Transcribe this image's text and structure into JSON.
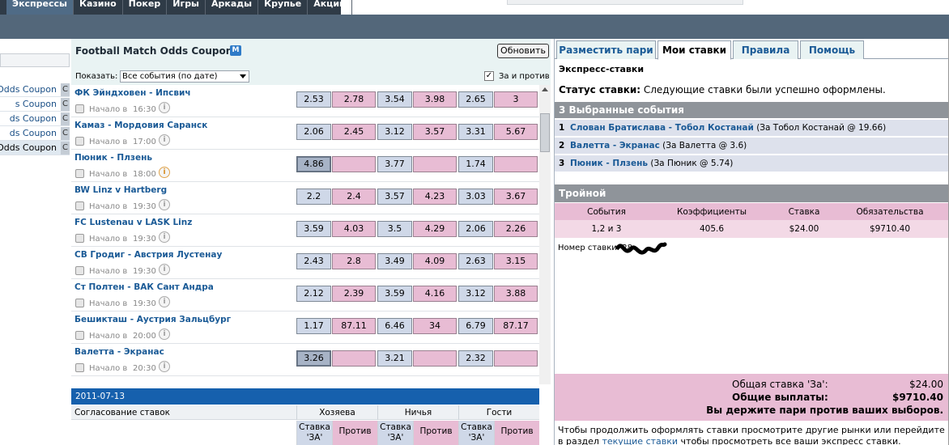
{
  "topnav": {
    "tabs": [
      "Экспрессы",
      "Казино",
      "Покер",
      "Игры",
      "Аркады",
      "Крупье",
      "Акции"
    ]
  },
  "sidebar": {
    "items": [
      "Odds Coupon",
      "s Coupon",
      "ds Coupon",
      "ds Coupon",
      "Odds Coupon"
    ],
    "c_label": "C"
  },
  "coupon": {
    "title": "Football Match Odds Coupon",
    "badge": "M",
    "refresh_label": "Обновить",
    "show_label": "Показать:",
    "show_value": "Все события (по дате)",
    "za_label": "За и против",
    "start_label": "Начало в",
    "matches": [
      {
        "name": "ФК Эйндховен - Ипсвич",
        "time": "16:30",
        "odds": [
          "2.53",
          "2.78",
          "3.54",
          "3.98",
          "2.65",
          "3"
        ]
      },
      {
        "name": "Камаз - Мордовия Саранск",
        "time": "17:00",
        "odds": [
          "2.06",
          "2.45",
          "3.12",
          "3.57",
          "3.31",
          "5.67"
        ]
      },
      {
        "name": "Пюник - Плзень",
        "time": "18:00",
        "odds": [
          "4.86",
          "",
          "3.77",
          "",
          "1.74",
          ""
        ]
      },
      {
        "name": "BW Linz v Hartberg",
        "time": "19:30",
        "odds": [
          "2.2",
          "2.4",
          "3.57",
          "4.23",
          "3.03",
          "3.67"
        ]
      },
      {
        "name": "FC Lustenau v LASK Linz",
        "time": "19:30",
        "odds": [
          "3.59",
          "4.03",
          "3.5",
          "4.29",
          "2.06",
          "2.26"
        ]
      },
      {
        "name": "СВ Гродиг - Австрия Лустенау",
        "time": "19:30",
        "odds": [
          "2.43",
          "2.8",
          "3.49",
          "4.09",
          "2.63",
          "3.15"
        ]
      },
      {
        "name": "Ст Полтен - ВАК Сант Андра",
        "time": "19:30",
        "odds": [
          "2.12",
          "2.39",
          "3.59",
          "4.16",
          "3.12",
          "3.88"
        ]
      },
      {
        "name": "Бешикташ - Аустрия Зальцбург",
        "time": "20:00",
        "odds": [
          "1.17",
          "87.11",
          "6.46",
          "34",
          "6.79",
          "87.17"
        ]
      },
      {
        "name": "Валетта - Экранас",
        "time": "20:30",
        "odds": [
          "3.26",
          "",
          "3.21",
          "",
          "2.32",
          ""
        ]
      }
    ],
    "date": "2011-07-13",
    "agreement_label": "Согласование ставок",
    "groups": [
      "Хозяева",
      "Ничья",
      "Гости"
    ],
    "sub_for": "Ставка 'ЗА'",
    "sub_against": "Против"
  },
  "betslip": {
    "tabs": [
      "Разместить пари",
      "Мои ставки",
      "Правила",
      "Помощь"
    ],
    "title": "Экспресс-ставки",
    "status_label": "Статус ставки:",
    "status_text": "Следующие ставки были успешно оформлены.",
    "selections_head": "3 Выбранные события",
    "selections": [
      {
        "num": "1",
        "event": "Слован Братислава - Тобол Костанай",
        "detail": "(За  Тобол Костанай @ 19.66)"
      },
      {
        "num": "2",
        "event": "Валетта - Экранас",
        "detail": "(За  Валетта @ 3.6)"
      },
      {
        "num": "3",
        "event": "Пюник - Плзень",
        "detail": "(За  Пюник @ 5.74)"
      }
    ],
    "triple_head": "Тройной",
    "cols": [
      "События",
      "Коэффициенты",
      "Ставка",
      "Обязательства"
    ],
    "vals": [
      "1,2 и 3",
      "405.6",
      "$24.00",
      "$9710.40"
    ],
    "ticket_label": "Номер ставки: 28",
    "total_stake_label": "Общая ставка 'За':",
    "total_stake": "$24.00",
    "total_payout_label": "Общие выплаты:",
    "total_payout": "$9710.40",
    "hold_text": "Вы держите пари против ваших выборов.",
    "footer_text1": "Чтобы продолжить оформлять ставки просмотрите другие рынки или перейдите в раздел",
    "footer_link": "текущие ставки",
    "footer_text2": "чтобы просмотреть все ваши экспресс ставки."
  }
}
